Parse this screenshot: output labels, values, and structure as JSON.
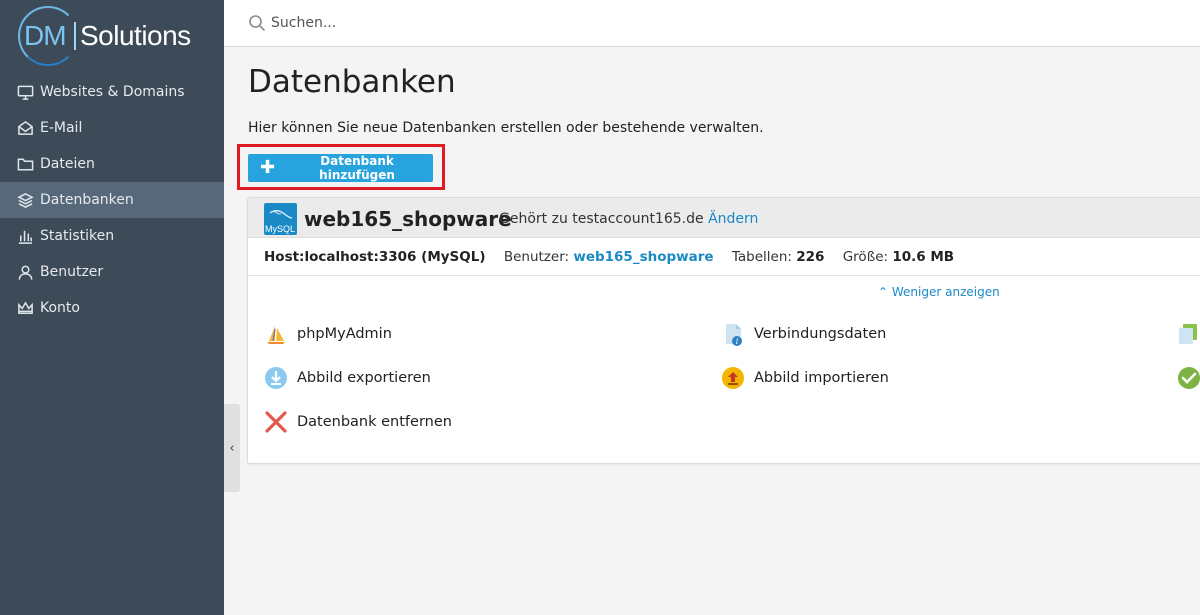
{
  "brand": {
    "logo_prefix": "DM",
    "logo_suffix": "Solutions"
  },
  "sidebar": {
    "items": [
      {
        "label": "Websites & Domains",
        "icon": "monitor-icon",
        "active": false
      },
      {
        "label": "E-Mail",
        "icon": "mail-icon",
        "active": false
      },
      {
        "label": "Dateien",
        "icon": "folder-icon",
        "active": false
      },
      {
        "label": "Datenbanken",
        "icon": "layers-icon",
        "active": true
      },
      {
        "label": "Statistiken",
        "icon": "bar-chart-icon",
        "active": false
      },
      {
        "label": "Benutzer",
        "icon": "user-icon",
        "active": false
      },
      {
        "label": "Konto",
        "icon": "crown-icon",
        "active": false
      }
    ]
  },
  "search": {
    "placeholder": "Suchen..."
  },
  "page": {
    "title": "Datenbanken",
    "description": "Hier können Sie neue Datenbanken erstellen oder bestehende verwalten.",
    "add_button": "Datenbank hinzufügen"
  },
  "database": {
    "logo_text": "MySQL",
    "name": "web165_shopware",
    "owner_prefix": "Gehört zu testaccount165.de",
    "change_link": "Ändern",
    "host_label": "Host:localhost:3306 (MySQL)",
    "user_label": "Benutzer:",
    "user_value": "web165_shopware",
    "tables_label": "Tabellen:",
    "tables_value": "226",
    "size_label": "Größe:",
    "size_value": "10.6 MB",
    "toggle_label": "Weniger anzeigen"
  },
  "tools": {
    "phpmyadmin": "phpMyAdmin",
    "connection": "Verbindungsdaten",
    "export": "Abbild exportieren",
    "import": "Abbild importieren",
    "remove": "Datenbank entfernen"
  },
  "colors": {
    "sidebar": "#3d4b59",
    "active": "#56687a",
    "accent": "#27a3dd",
    "highlight": "#e01b24",
    "link": "#1b8ac3"
  }
}
